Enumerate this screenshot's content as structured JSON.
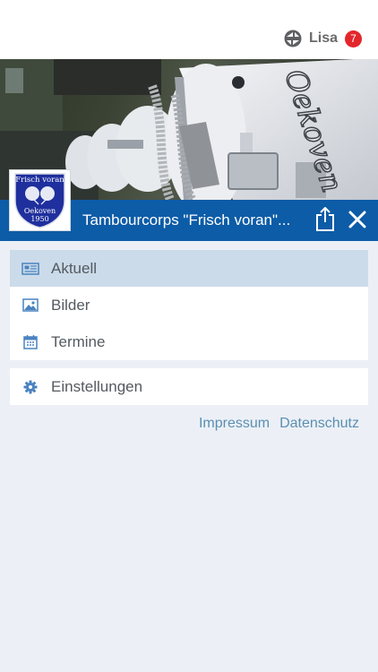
{
  "header": {
    "user_name": "Lisa",
    "notification_count": "7",
    "user_icon": "community-logo-icon",
    "badge_color": "#e3262b"
  },
  "group": {
    "title": "Tambourcorps \"Frisch voran\"...",
    "logo_top_text": "Frisch voran",
    "logo_bottom_text": "Oekoven",
    "logo_year": "1950",
    "drum_lettering": "Oekoven",
    "titlebar_color": "#0d5ca7"
  },
  "menu": {
    "items": [
      {
        "label": "Aktuell",
        "icon": "newspaper-icon",
        "active": true
      },
      {
        "label": "Bilder",
        "icon": "image-icon",
        "active": false
      },
      {
        "label": "Termine",
        "icon": "calendar-icon",
        "active": false
      }
    ],
    "settings": {
      "label": "Einstellungen",
      "icon": "gear-icon"
    }
  },
  "footer": {
    "impressum": "Impressum",
    "datenschutz": "Datenschutz",
    "link_color": "#5b8fb1"
  }
}
